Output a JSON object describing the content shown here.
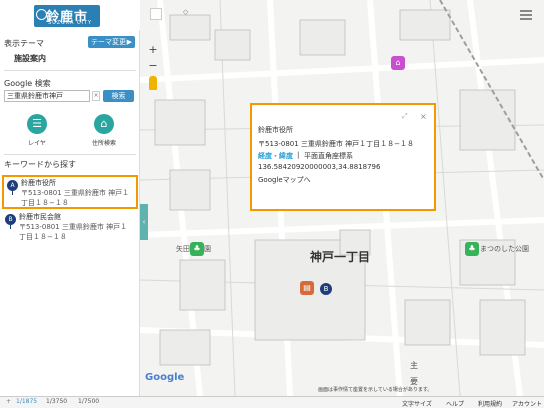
{
  "header": {
    "logo_main": "鈴鹿市",
    "logo_sub": "SUZUKA CITY"
  },
  "sidebar": {
    "theme_label": "表示テーマ",
    "theme_change_label": "テーマ変更",
    "theme_value": "施設案内",
    "google_search_label": "Google 検索",
    "search_value": "三重県鈴鹿市神戸",
    "search_button": "検索",
    "clear_button": "×",
    "tools": [
      {
        "label": "レイヤ",
        "icon": "list-icon"
      },
      {
        "label": "住所検索",
        "icon": "house-icon"
      }
    ],
    "keyword_label": "キーワードから探す",
    "results": [
      {
        "pin": "A",
        "title": "鈴鹿市役所",
        "address": "〒513-0801 三重県鈴鹿市 神戸１丁目１８−１８"
      },
      {
        "pin": "B",
        "title": "鈴鹿市民会館",
        "address": "〒513-0801 三重県鈴鹿市 神戸１丁目１８−１８"
      }
    ]
  },
  "map": {
    "zoom_in": "+",
    "zoom_out": "−",
    "collapse": "‹",
    "google_logo": "Google",
    "area_label": "神戸一丁目",
    "park_left": "矢田部公園",
    "park_right": "まつのした公園",
    "shu_label": "主",
    "you_label": "要",
    "marker_a": "A",
    "marker_b": "B",
    "marker_icons": [
      "school-icon",
      "hospital-icon",
      "library-icon",
      "park-icon"
    ],
    "popup": {
      "title": "鈴鹿市役所",
      "address": "〒513-0801 三重県鈴鹿市 神戸１丁目１８−１８",
      "coord_label": "経度・緯度",
      "coord_sep": "|",
      "coord_system": "平面直角座標系",
      "coord_value": "136.58420920000003,34.8818796",
      "gmaps_link": "Googleマップへ",
      "close": "×"
    }
  },
  "footer": {
    "scales": [
      "1/1875",
      "1/3750",
      "1/7500"
    ],
    "note": "画面は事作情て座置を示している場合があります。",
    "links": [
      "文字サイズ",
      "ヘルプ",
      "利用規約",
      "アカウント"
    ],
    "map_credit": "利用規約"
  },
  "colors": {
    "accent": "#3a8fc4",
    "teal": "#2aa59f",
    "highlight": "#f39800",
    "pin": "#1e3d7b"
  }
}
